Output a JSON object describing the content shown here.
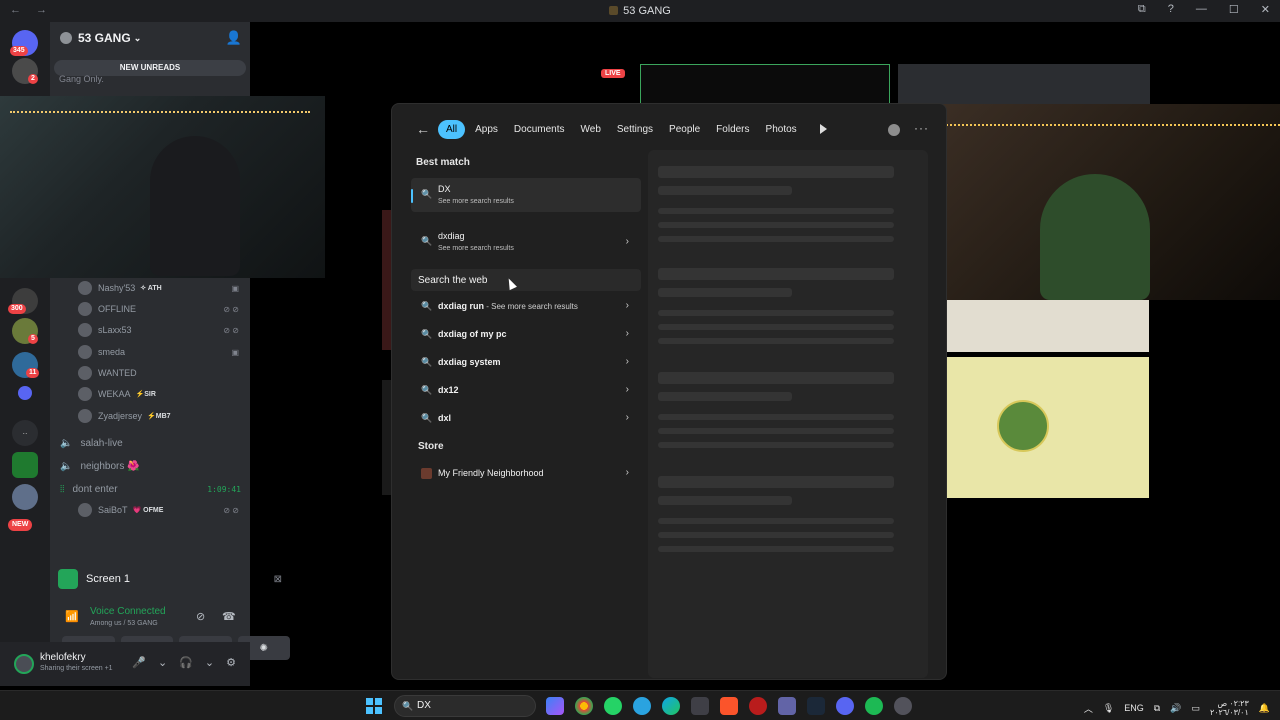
{
  "window": {
    "title": "53 GANG",
    "nav": "← →",
    "controls": [
      "⧉",
      "?",
      "—",
      "☐",
      "✕"
    ]
  },
  "servers": [
    {
      "badge": "345"
    },
    {
      "badge": "2"
    },
    {
      "badge": "300"
    },
    {
      "badge": "5"
    },
    {
      "badge": "11"
    },
    {
      "badge": ""
    },
    {
      "badge": ""
    },
    {
      "badge": ""
    },
    {
      "badge": ""
    },
    {
      "badge": "NEW"
    }
  ],
  "guild": {
    "name": "53 GANG",
    "new_unreads": "NEW UNREADS",
    "category": "Gang Only."
  },
  "members": [
    {
      "name": "Nashy'53",
      "tag": "✧ ATH",
      "icons": ""
    },
    {
      "name": "OFFLINE",
      "tag": "",
      "icons": "⊘ ⊘"
    },
    {
      "name": "sLaxx53",
      "tag": "",
      "icons": "⊘ ⊘"
    },
    {
      "name": "smeda",
      "tag": "",
      "icons": ""
    },
    {
      "name": "WANTED",
      "tag": "",
      "icons": ""
    },
    {
      "name": "WEKAA",
      "tag": "⚡SIR",
      "icons": ""
    },
    {
      "name": "Zyadjersey",
      "tag": "⚡MB7",
      "icons": ""
    }
  ],
  "voice_channels": [
    {
      "name": "salah-live",
      "time": ""
    },
    {
      "name": "neighbors 🌺",
      "time": ""
    },
    {
      "name": "dont enter",
      "time": "1:09:41"
    }
  ],
  "dont_enter_member": {
    "name": "SaiBoT",
    "tag": "💗 OFME",
    "icons": "⊘ ⊘"
  },
  "screen_panel": {
    "label": "Screen 1"
  },
  "voice": {
    "status": "Voice Connected",
    "location": "Among us / 53 GANG"
  },
  "voice_controls": [
    "⊘",
    "▣",
    "✣",
    "✺"
  ],
  "user": {
    "name": "khelofekry",
    "status": "Sharing their screen +1",
    "controls": [
      "🎤",
      "⌄",
      "🎧",
      "⌄",
      "⚙"
    ]
  },
  "stage": {
    "live_label": "LIVE"
  },
  "search": {
    "tabs": [
      "All",
      "Apps",
      "Documents",
      "Web",
      "Settings",
      "People",
      "Folders",
      "Photos"
    ],
    "best_match_header": "Best match",
    "best_match": {
      "title": "DX",
      "subtitle": "See more search results"
    },
    "second": {
      "title": "dxdiag",
      "subtitle": "See more search results"
    },
    "web_header": "Search the web",
    "web_results": [
      {
        "title": "dxdiag run",
        "suffix": " - See more search results"
      },
      {
        "title": "dxdiag of my pc",
        "suffix": ""
      },
      {
        "title": "dxdiag system",
        "suffix": ""
      },
      {
        "title": "dx12",
        "suffix": ""
      },
      {
        "title": "dxl",
        "suffix": ""
      }
    ],
    "store_header": "Store",
    "store_result": {
      "title": "My Friendly Neighborhood"
    }
  },
  "taskbar": {
    "search_value": "DX",
    "tray": {
      "lang": "ENG",
      "time": "٠٢:٢٣ ص",
      "date": "٢٠٢٦/٠٣/٠١"
    }
  },
  "colors": {
    "accent": "#4cc2ff",
    "discord_green": "#23a559",
    "discord_red": "#ed4245"
  }
}
